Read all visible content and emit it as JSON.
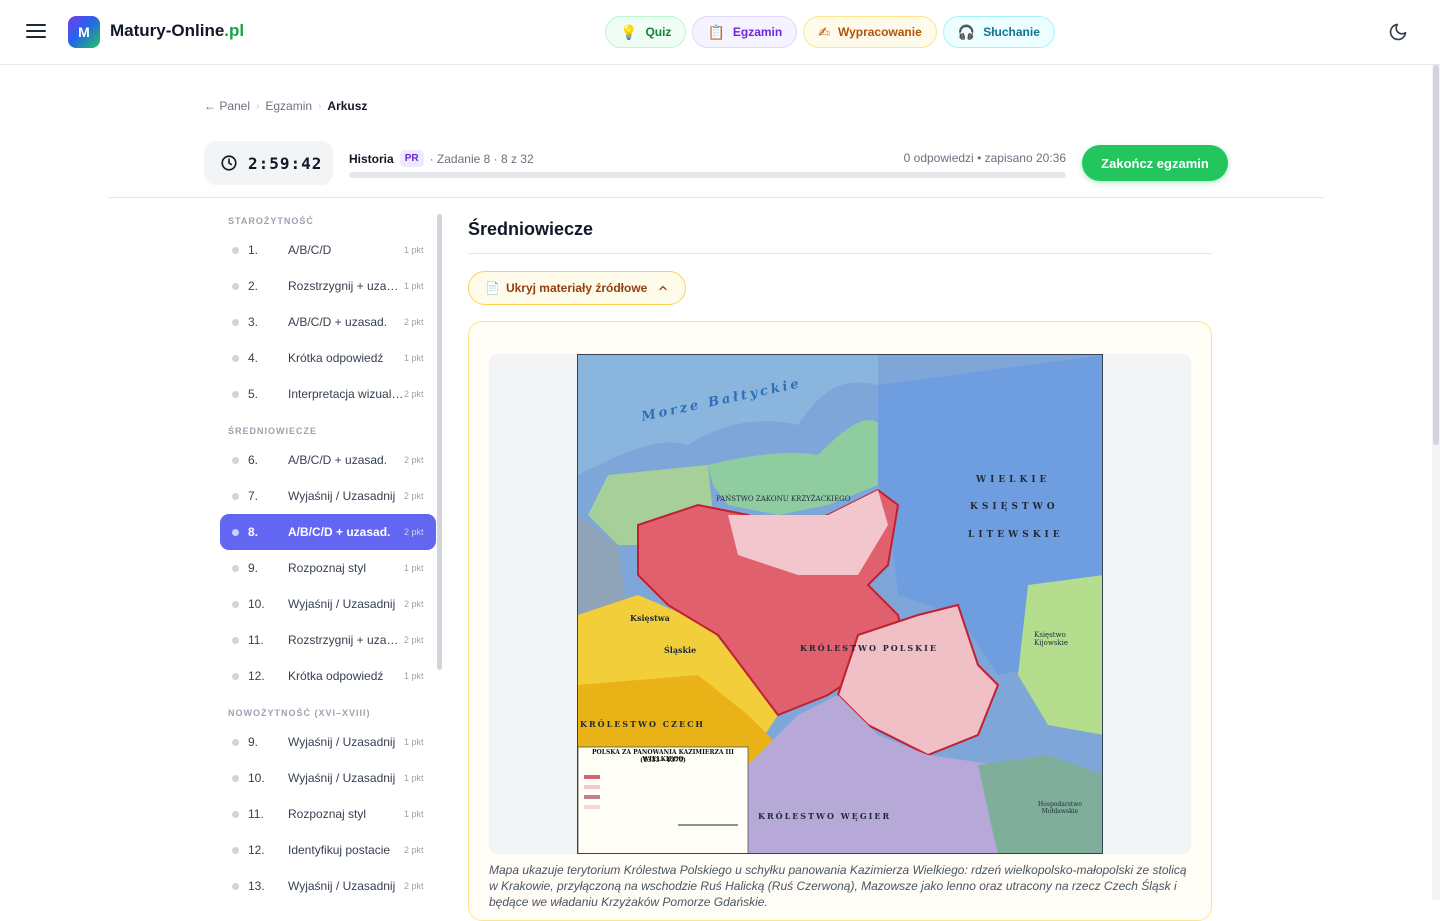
{
  "header": {
    "brand_name": "Matury-Online",
    "brand_tld": ".pl",
    "logo_letter": "M",
    "nav": [
      {
        "label": "Quiz",
        "icon": "lightbulb-icon"
      },
      {
        "label": "Egzamin",
        "icon": "clipboard-icon"
      },
      {
        "label": "Wypracowanie",
        "icon": "writing-hand-icon"
      },
      {
        "label": "Słuchanie",
        "icon": "headphones-icon"
      }
    ]
  },
  "breadcrumb": {
    "panel": "← Panel",
    "exam": "Egzamin",
    "current": "Arkusz"
  },
  "exam_bar": {
    "timer": "2:59:42",
    "subject": "Historia",
    "level": "PR",
    "task": "· Zadanie 8 · 8 z 32",
    "answers": "0 odpowiedzi",
    "saved": "• zapisano 20:36",
    "progress_fraction": 0.0,
    "finish_label": "Zakończ egzamin"
  },
  "sidebar": {
    "sections": [
      {
        "title": "STAROŻYTNOŚĆ",
        "items": [
          {
            "num": "1.",
            "label": "A/B/C/D",
            "pts": "1 pkt"
          },
          {
            "num": "2.",
            "label": "Rozstrzygnij + uzasad.",
            "pts": "1 pkt"
          },
          {
            "num": "3.",
            "label": "A/B/C/D + uzasad.",
            "pts": "2 pkt"
          },
          {
            "num": "4.",
            "label": "Krótka odpowiedź",
            "pts": "1 pkt"
          },
          {
            "num": "5.",
            "label": "Interpretacja wizualna",
            "pts": "2 pkt"
          }
        ]
      },
      {
        "title": "ŚREDNIOWIECZE",
        "items": [
          {
            "num": "6.",
            "label": "A/B/C/D + uzasad.",
            "pts": "2 pkt"
          },
          {
            "num": "7.",
            "label": "Wyjaśnij / Uzasadnij",
            "pts": "2 pkt"
          },
          {
            "num": "8.",
            "label": "A/B/C/D + uzasad.",
            "pts": "2 pkt",
            "active": true
          },
          {
            "num": "9.",
            "label": "Rozpoznaj styl",
            "pts": "1 pkt"
          },
          {
            "num": "10.",
            "label": "Wyjaśnij / Uzasadnij",
            "pts": "2 pkt"
          },
          {
            "num": "11.",
            "label": "Rozstrzygnij + uzasad.",
            "pts": "2 pkt"
          },
          {
            "num": "12.",
            "label": "Krótka odpowiedź",
            "pts": "1 pkt"
          }
        ]
      },
      {
        "title": "NOWOŻYTNOŚĆ (XVI–XVIII)",
        "items": [
          {
            "num": "9.",
            "label": "Wyjaśnij / Uzasadnij",
            "pts": "1 pkt"
          },
          {
            "num": "10.",
            "label": "Wyjaśnij / Uzasadnij",
            "pts": "1 pkt"
          },
          {
            "num": "11.",
            "label": "Rozpoznaj styl",
            "pts": "1 pkt"
          },
          {
            "num": "12.",
            "label": "Identyfikuj postacie",
            "pts": "2 pkt"
          },
          {
            "num": "13.",
            "label": "Wyjaśnij / Uzasadnij",
            "pts": "2 pkt"
          }
        ]
      }
    ]
  },
  "main": {
    "title": "Średniowiecze",
    "toggle_label": "Ukryj materiały źródłowe",
    "map": {
      "sea": "Morze Bałtyckie",
      "teutonic": "PAŃSTWO ZAKONU KRZYŻACKIEGO",
      "lithuania": [
        "WIELKIE",
        "KSIĘSTWO",
        "LITEWSKIE"
      ],
      "poland": "KRÓLESTWO POLSKIE",
      "bohemia": "KRÓLESTWO CZECH",
      "hungary": "KRÓLESTWO WĘGIER",
      "kiev": "Księstwo Kijowskie",
      "silesia_1": "Księstwa",
      "silesia_2": "Śląskie",
      "moldavia": "Hospodarstwo Mołdawskie",
      "legend_title": "POLSKA ZA PANOWANIA KAZIMIERZA III WIELKIEGO",
      "legend_years": "(1333 - 1370)"
    },
    "caption": "Mapa ukazuje terytorium Królestwa Polskiego u schyłku panowania Kazimierza Wielkiego: rdzeń wielkopolsko-małopolski ze stolicą w Krakowie, przyłączoną na wschodzie Ruś Halicką (Ruś Czerwoną), Mazowsze jako lenno oraz utracony na rzecz Czech Śląsk i będące we władaniu Krzyżaków Pomorze Gdańskie."
  },
  "colors": {
    "accent": "#6366f1",
    "success": "#22c55e",
    "poland_red": "#e0606e"
  }
}
